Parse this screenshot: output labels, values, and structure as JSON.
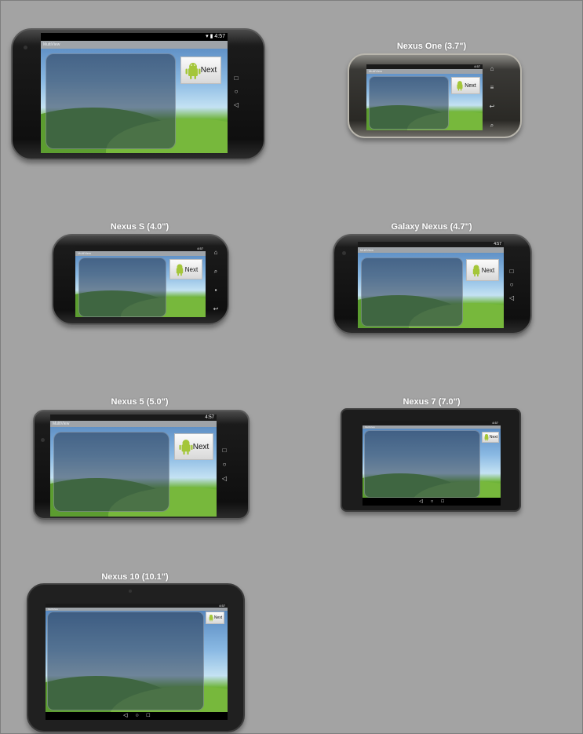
{
  "devices": [
    {
      "id": "nexus-4",
      "label": "",
      "status_time": "4:57",
      "app_title": "MultiView",
      "next_label": "Next"
    },
    {
      "id": "nexus-one",
      "label": "Nexus One (3.7\")",
      "status_time": "4:57",
      "app_title": "MultiView",
      "next_label": "Next"
    },
    {
      "id": "nexus-s",
      "label": "Nexus S (4.0\")",
      "status_time": "4:57",
      "app_title": "MultiView",
      "next_label": "Next"
    },
    {
      "id": "galaxy-nexus",
      "label": "Galaxy Nexus (4.7\")",
      "status_time": "4:57",
      "app_title": "MultiView",
      "next_label": "Next"
    },
    {
      "id": "nexus-5",
      "label": "Nexus 5 (5.0\")",
      "status_time": "4:57",
      "app_title": "MultiView",
      "next_label": "Next"
    },
    {
      "id": "nexus-7",
      "label": "Nexus 7 (7.0\")",
      "status_time": "4:57",
      "app_title": "MultiView",
      "next_label": "Next"
    },
    {
      "id": "nexus-10",
      "label": "Nexus 10 (10.1\")",
      "status_time": "4:57",
      "app_title": "MultiView",
      "next_label": "Next"
    }
  ],
  "icons": {
    "back": "back-icon",
    "home": "home-icon",
    "recents": "recents-icon",
    "android": "android-robot-icon",
    "wifi": "wifi-icon",
    "battery": "battery-icon"
  },
  "colors": {
    "background": "#a3a3a3",
    "android_green": "#a4c639",
    "label_text": "#ffffff"
  }
}
